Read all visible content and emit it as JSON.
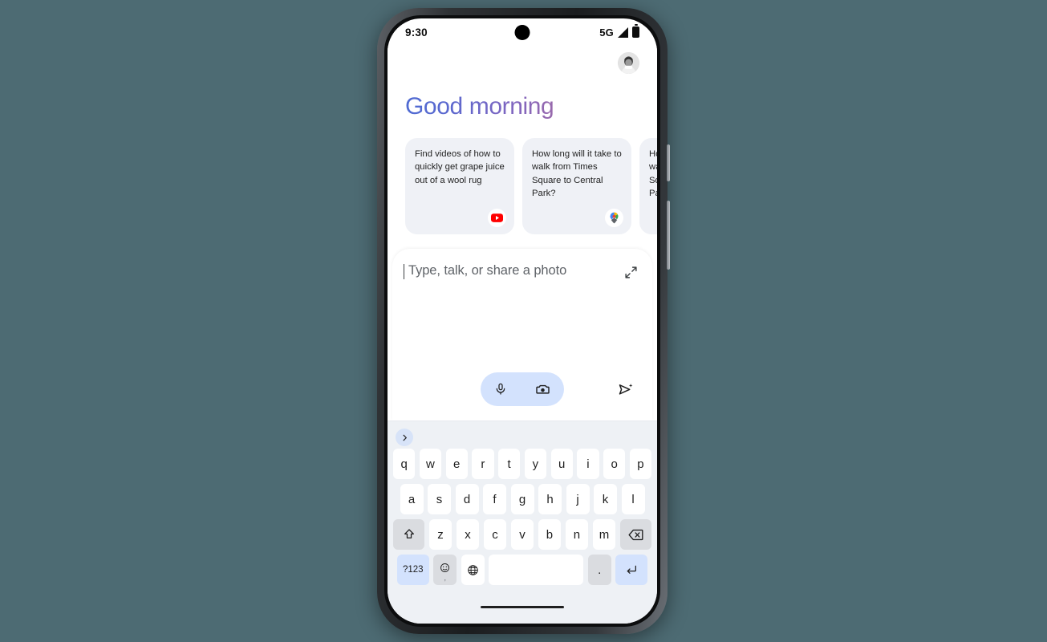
{
  "status_bar": {
    "clock": "9:30",
    "network": "5G",
    "signal_icon": "signal-bars-icon",
    "battery_icon": "battery-full-icon",
    "camera_icon": "front-camera-dot"
  },
  "header": {
    "avatar_name": "profile-avatar",
    "greeting": "Good morning"
  },
  "suggestions": [
    {
      "text": "Find videos of how to quickly get grape juice out of a wool rug",
      "badge_icon": "youtube-icon"
    },
    {
      "text": "How long will it take to walk from Times Square to Central Park?",
      "badge_icon": "google-maps-pin-icon"
    },
    {
      "text": "How long will it take to walk from Times Square to Central Park?",
      "badge_icon": "google-maps-pin-icon"
    }
  ],
  "compose": {
    "placeholder": "Type, talk, or share a photo",
    "value": "",
    "expand_icon": "expand-diagonal-icon",
    "mic_icon": "microphone-icon",
    "camera_icon": "camera-icon",
    "send_icon": "send-sparkle-icon"
  },
  "keyboard": {
    "toolbar_icon": "chevron-right-icon",
    "row1": [
      "q",
      "w",
      "e",
      "r",
      "t",
      "y",
      "u",
      "i",
      "o",
      "p"
    ],
    "row2": [
      "a",
      "s",
      "d",
      "f",
      "g",
      "h",
      "j",
      "k",
      "l"
    ],
    "row3_letters": [
      "z",
      "x",
      "c",
      "v",
      "b",
      "n",
      "m"
    ],
    "shift_icon": "shift-up-arrow-icon",
    "backspace_icon": "backspace-icon",
    "numbers_label": "?123",
    "emoji_icon": "emoji-smiley-icon",
    "comma_label": ",",
    "globe_icon": "language-globe-icon",
    "space_label": "",
    "period_label": ".",
    "enter_icon": "enter-return-icon"
  },
  "system": {
    "home_indicator": "home-gesture-bar"
  },
  "colors": {
    "page_background": "#4d6b73",
    "card_background": "#eff1f6",
    "accent_pill": "#d3e2fd",
    "keyboard_background": "#eef1f5",
    "greeting_gradient_start": "#4a6cd4",
    "greeting_gradient_end": "#b4688c",
    "youtube_red": "#ff0000"
  }
}
